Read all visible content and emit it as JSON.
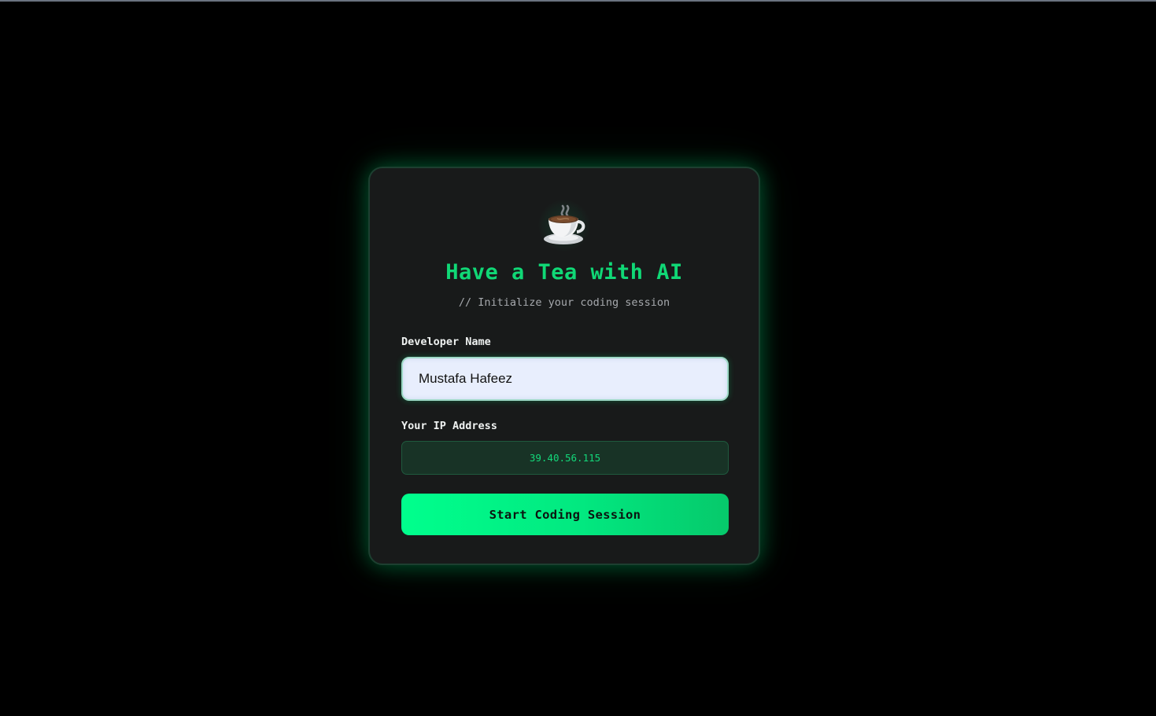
{
  "header": {
    "logo_icon": "hot-beverage-icon",
    "title": "Have a Tea with AI",
    "subtitle": "// Initialize your coding session"
  },
  "form": {
    "name_label": "Developer Name",
    "name_value": "Mustafa Hafeez",
    "ip_label": "Your IP Address",
    "ip_value": "39.40.56.115",
    "submit_label": "Start Coding Session"
  },
  "colors": {
    "background": "#000000",
    "card": "#181a1a",
    "accent": "#10d876",
    "button": "#00ff8d",
    "input_background": "#e8eefd"
  }
}
